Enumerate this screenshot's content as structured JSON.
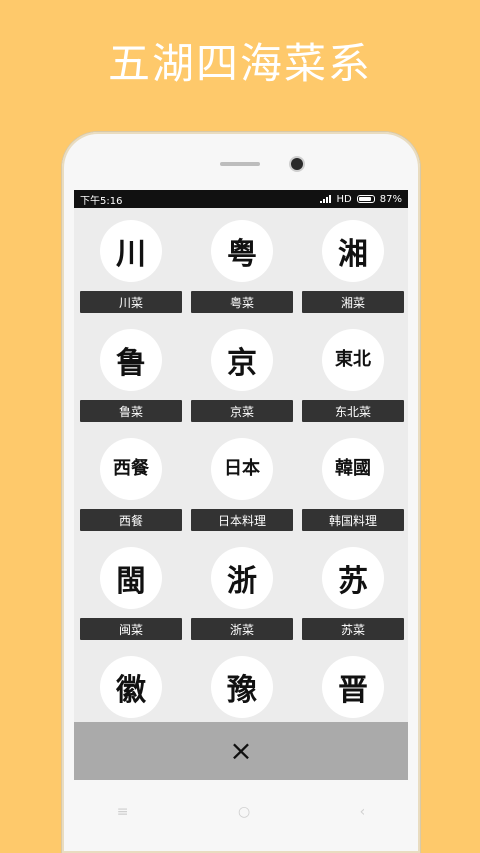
{
  "headline": "五湖四海菜系",
  "status": {
    "time": "下午5:16",
    "network": "HD",
    "battery": "87%"
  },
  "cuisines": [
    {
      "glyph": "川",
      "label": "川菜"
    },
    {
      "glyph": "粤",
      "label": "粤菜"
    },
    {
      "glyph": "湘",
      "label": "湘菜"
    },
    {
      "glyph": "鲁",
      "label": "鲁菜"
    },
    {
      "glyph": "京",
      "label": "京菜"
    },
    {
      "glyph": "東北",
      "label": "东北菜"
    },
    {
      "glyph": "西餐",
      "label": "西餐"
    },
    {
      "glyph": "日本",
      "label": "日本料理"
    },
    {
      "glyph": "韓國",
      "label": "韩国料理"
    },
    {
      "glyph": "閩",
      "label": "闽菜"
    },
    {
      "glyph": "浙",
      "label": "浙菜"
    },
    {
      "glyph": "苏",
      "label": "苏菜"
    },
    {
      "glyph": "徽",
      "label": ""
    },
    {
      "glyph": "豫",
      "label": ""
    },
    {
      "glyph": "晋",
      "label": ""
    }
  ],
  "close_button": {
    "icon": "close-icon",
    "glyph": "×"
  },
  "nav": {
    "menu": "≡",
    "home": "○",
    "back": "‹"
  }
}
